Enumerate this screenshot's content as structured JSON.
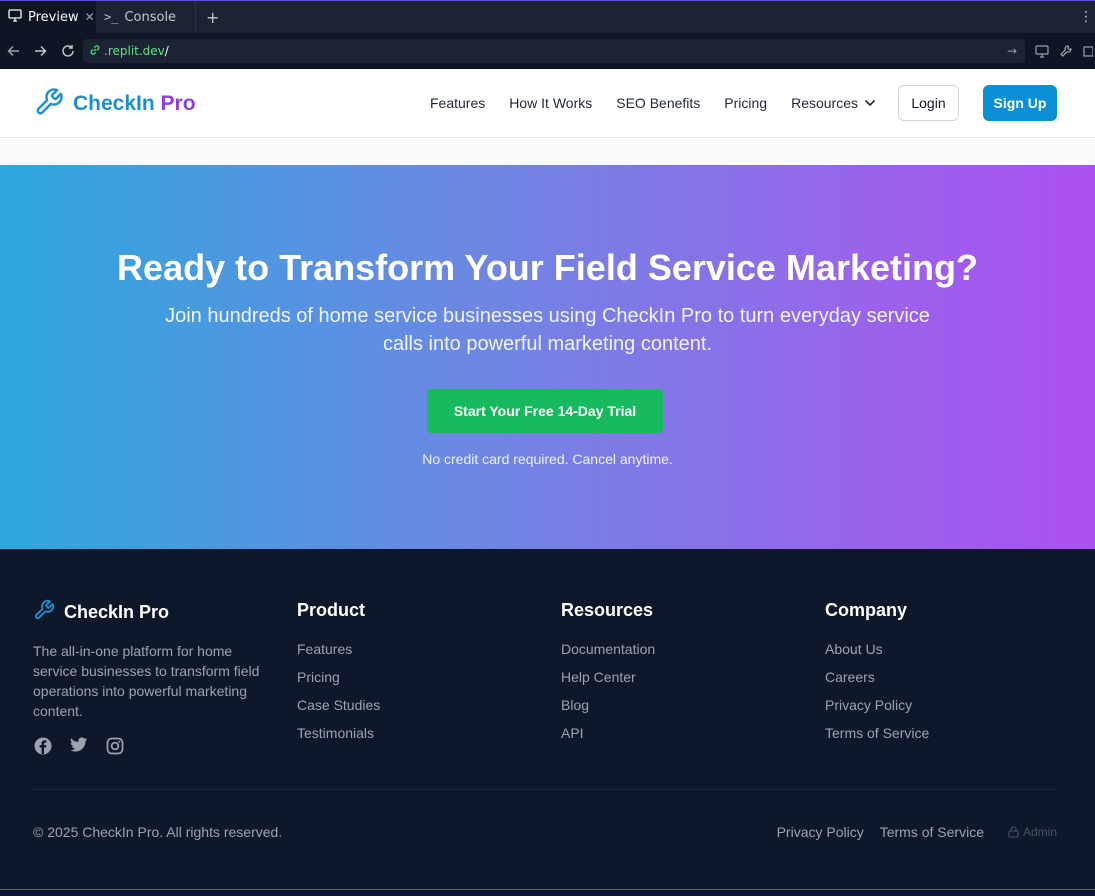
{
  "browser": {
    "tabs": [
      {
        "label": "Preview",
        "icon": "monitor-icon"
      },
      {
        "label": "Console",
        "icon": "terminal-icon"
      }
    ],
    "url_host": ".replit.dev",
    "url_path": "/"
  },
  "header": {
    "logo_part1": "CheckIn",
    "logo_part2": "Pro",
    "nav": [
      "Features",
      "How It Works",
      "SEO Benefits",
      "Pricing",
      "Resources"
    ],
    "login": "Login",
    "signup": "Sign Up",
    "colors": {
      "brand_blue": "#1d8fd1",
      "brand_purple": "#8b3fe0",
      "signup_bg": "#0b8fd6"
    }
  },
  "hero": {
    "title": "Ready to Transform Your Field Service Marketing?",
    "subtitle": "Join hundreds of home service businesses using CheckIn Pro to turn everyday service calls into powerful marketing content.",
    "cta": "Start Your Free 14-Day Trial",
    "note": "No credit card required. Cancel anytime.",
    "colors": {
      "gradient_start": "#2ea8dc",
      "gradient_end": "#ab50f0",
      "cta_bg": "#16b95d"
    }
  },
  "footer": {
    "brand": "CheckIn Pro",
    "description": "The all-in-one platform for home service businesses to transform field operations into powerful marketing content.",
    "social": [
      "facebook-icon",
      "twitter-icon",
      "instagram-icon"
    ],
    "columns": [
      {
        "title": "Product",
        "links": [
          "Features",
          "Pricing",
          "Case Studies",
          "Testimonials"
        ]
      },
      {
        "title": "Resources",
        "links": [
          "Documentation",
          "Help Center",
          "Blog",
          "API"
        ]
      },
      {
        "title": "Company",
        "links": [
          "About Us",
          "Careers",
          "Privacy Policy",
          "Terms of Service"
        ]
      }
    ],
    "copyright": "© 2025 CheckIn Pro. All rights reserved.",
    "bottom_links": [
      "Privacy Policy",
      "Terms of Service"
    ],
    "admin": "Admin"
  }
}
